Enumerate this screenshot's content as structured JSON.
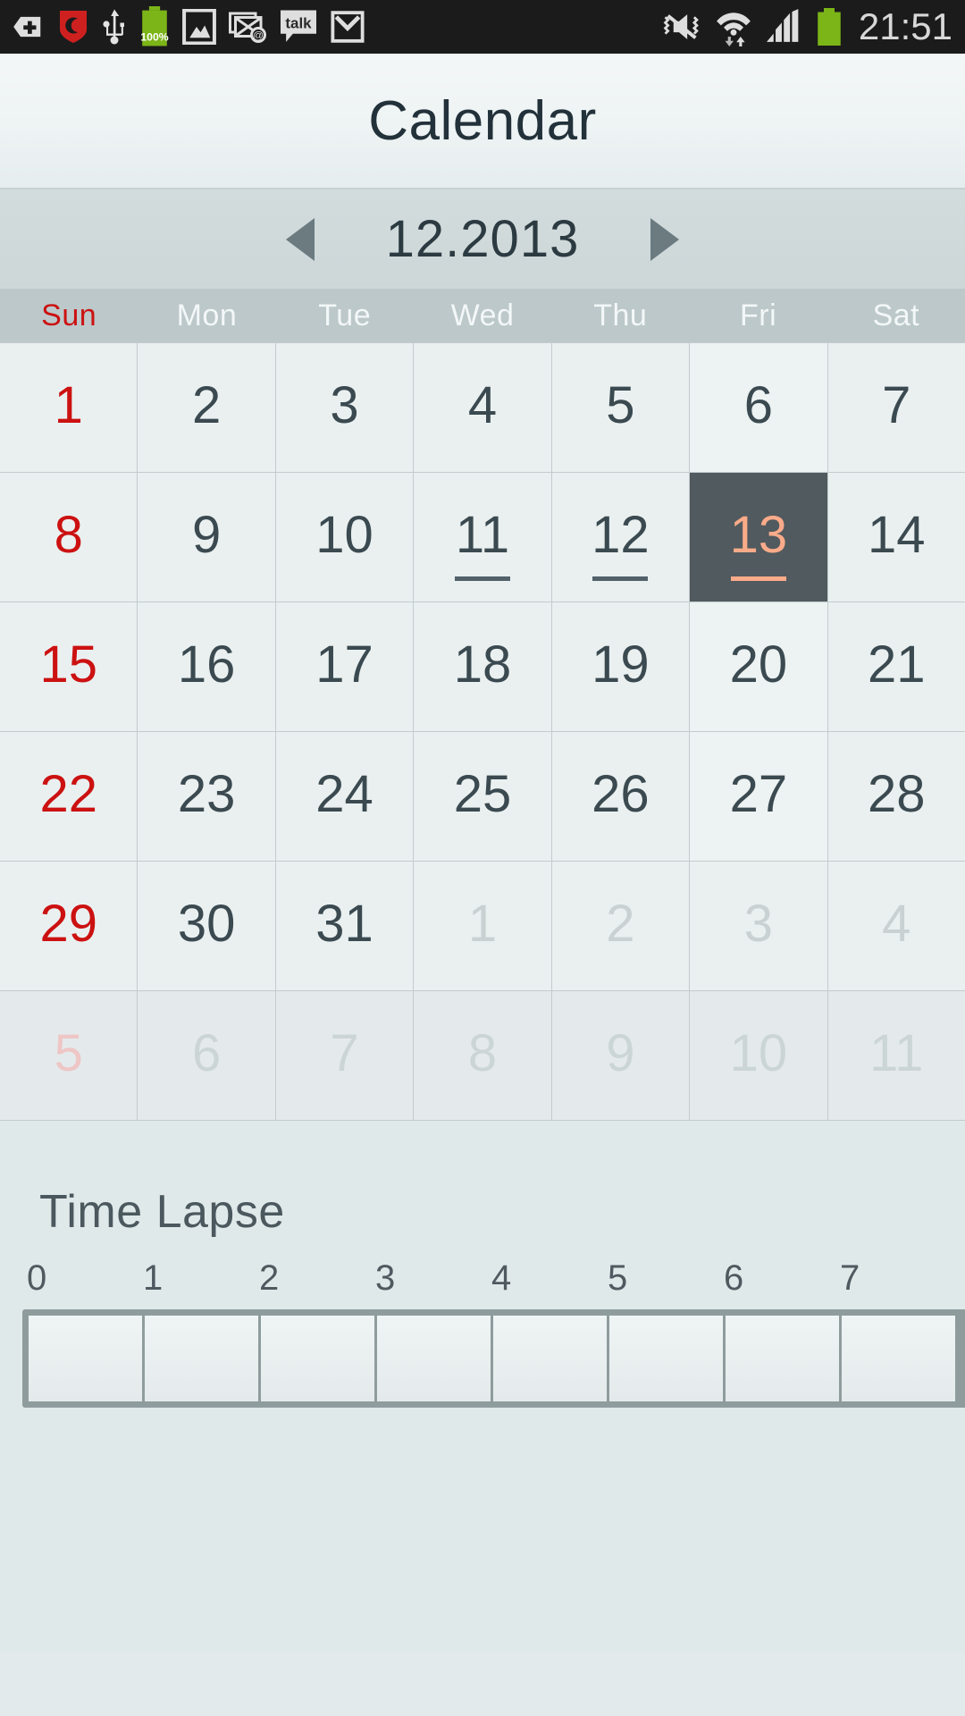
{
  "status_bar": {
    "time": "21:51",
    "battery_percent": "100%",
    "icons_left": [
      {
        "name": "back-plus-icon",
        "label": "back-plus"
      },
      {
        "name": "shield-icon",
        "label": "shield"
      },
      {
        "name": "usb-icon",
        "label": "usb"
      },
      {
        "name": "battery-charging-icon",
        "label": "battery-100"
      },
      {
        "name": "gallery-icon",
        "label": "gallery"
      },
      {
        "name": "email-icon",
        "label": "email"
      },
      {
        "name": "talk-icon",
        "label": "talk"
      },
      {
        "name": "gmail-icon",
        "label": "gmail"
      }
    ],
    "icons_right": [
      {
        "name": "mute-vibrate-icon",
        "label": "mute-vibrate"
      },
      {
        "name": "wifi-icon",
        "label": "wifi"
      },
      {
        "name": "signal-icon",
        "label": "signal"
      },
      {
        "name": "battery-icon",
        "label": "battery"
      }
    ]
  },
  "action_bar": {
    "title": "Calendar"
  },
  "month_nav": {
    "prev_label": "◀",
    "next_label": "▶",
    "month_label": "12.2013"
  },
  "weekdays": [
    "Sun",
    "Mon",
    "Tue",
    "Wed",
    "Thu",
    "Fri",
    "Sat"
  ],
  "calendar": {
    "month": 12,
    "year": 2013,
    "today": 13,
    "marked_days": [
      11,
      12,
      13
    ],
    "weeks": [
      [
        {
          "day": "1",
          "state": "current",
          "weekend": true
        },
        {
          "day": "2",
          "state": "current",
          "weekend": false
        },
        {
          "day": "3",
          "state": "current",
          "weekend": false
        },
        {
          "day": "4",
          "state": "current",
          "weekend": false
        },
        {
          "day": "5",
          "state": "current",
          "weekend": false
        },
        {
          "day": "6",
          "state": "current",
          "weekend": false
        },
        {
          "day": "7",
          "state": "current",
          "weekend": false
        }
      ],
      [
        {
          "day": "8",
          "state": "current",
          "weekend": true
        },
        {
          "day": "9",
          "state": "current",
          "weekend": false
        },
        {
          "day": "10",
          "state": "current",
          "weekend": false
        },
        {
          "day": "11",
          "state": "current",
          "weekend": false,
          "marker": true
        },
        {
          "day": "12",
          "state": "current",
          "weekend": false,
          "marker": true
        },
        {
          "day": "13",
          "state": "today",
          "weekend": false,
          "marker": true
        },
        {
          "day": "14",
          "state": "current",
          "weekend": false
        }
      ],
      [
        {
          "day": "15",
          "state": "current",
          "weekend": true
        },
        {
          "day": "16",
          "state": "current",
          "weekend": false
        },
        {
          "day": "17",
          "state": "current",
          "weekend": false
        },
        {
          "day": "18",
          "state": "current",
          "weekend": false
        },
        {
          "day": "19",
          "state": "current",
          "weekend": false
        },
        {
          "day": "20",
          "state": "current",
          "weekend": false
        },
        {
          "day": "21",
          "state": "current",
          "weekend": false
        }
      ],
      [
        {
          "day": "22",
          "state": "current",
          "weekend": true
        },
        {
          "day": "23",
          "state": "current",
          "weekend": false
        },
        {
          "day": "24",
          "state": "current",
          "weekend": false
        },
        {
          "day": "25",
          "state": "current",
          "weekend": false
        },
        {
          "day": "26",
          "state": "current",
          "weekend": false
        },
        {
          "day": "27",
          "state": "current",
          "weekend": false
        },
        {
          "day": "28",
          "state": "current",
          "weekend": false
        }
      ],
      [
        {
          "day": "29",
          "state": "current",
          "weekend": true
        },
        {
          "day": "30",
          "state": "current",
          "weekend": false
        },
        {
          "day": "31",
          "state": "current",
          "weekend": false
        },
        {
          "day": "1",
          "state": "other-month",
          "weekend": false
        },
        {
          "day": "2",
          "state": "other-month",
          "weekend": false
        },
        {
          "day": "3",
          "state": "other-month",
          "weekend": false
        },
        {
          "day": "4",
          "state": "other-month",
          "weekend": false
        }
      ],
      [
        {
          "day": "5",
          "state": "trailing",
          "weekend": true
        },
        {
          "day": "6",
          "state": "trailing",
          "weekend": false
        },
        {
          "day": "7",
          "state": "trailing",
          "weekend": false
        },
        {
          "day": "8",
          "state": "trailing",
          "weekend": false
        },
        {
          "day": "9",
          "state": "trailing",
          "weekend": false
        },
        {
          "day": "10",
          "state": "trailing",
          "weekend": false
        },
        {
          "day": "11",
          "state": "trailing",
          "weekend": false
        }
      ]
    ]
  },
  "timelapse": {
    "title": "Time Lapse",
    "tick_labels": [
      "0",
      "1",
      "2",
      "3",
      "4",
      "5",
      "6",
      "7"
    ],
    "cells": [
      "",
      "",
      "",
      "",
      "",
      "",
      "",
      ""
    ]
  },
  "colors": {
    "accent_weekend": "#cc1111",
    "today_bg": "#515a5e",
    "today_text": "#fbab8a",
    "grid_line": "#c3cbcd",
    "cell_bg": "#eaf0f0",
    "header_bg": "#bcc8ca",
    "page_bg": "#e0e9ea"
  }
}
